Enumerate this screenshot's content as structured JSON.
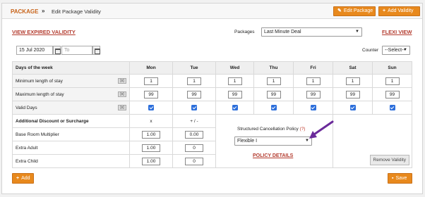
{
  "header": {
    "title": "PACKAGE",
    "separator": "»",
    "breadcrumb": "Edit Package Validity",
    "edit_button": "Edit Package",
    "add_validity_button": "Add Validity"
  },
  "toolbar": {
    "view_expired": "VIEW EXPIRED VALIDITY",
    "packages_label": "Packages",
    "packages_value": "Last Minute Deal",
    "flexi_view": "FLEXI VIEW",
    "from_date": "15 Jul 2020",
    "to_placeholder": "To",
    "counter_label": "Counter",
    "counter_value": "--Select--"
  },
  "grid": {
    "days_header": "Days of the week",
    "days": [
      "Mon",
      "Tue",
      "Wed",
      "Thu",
      "Fri",
      "Sat",
      "Sun"
    ],
    "min_label": "Minimum length of stay",
    "min_values": [
      "1",
      "1",
      "1",
      "1",
      "1",
      "1",
      "1"
    ],
    "max_label": "Maximum length of stay",
    "max_values": [
      "99",
      "99",
      "99",
      "99",
      "99",
      "99",
      "99"
    ],
    "valid_label": "Valid Days",
    "row_icon": "[x]",
    "additional_label": "Additional Discount or Surcharge",
    "x_label": "x",
    "pm_label": "+ / -",
    "base_label": "Base Room Multiplier",
    "base_x": "1.00",
    "base_pm": "0.00",
    "adult_label": "Extra Adult",
    "adult_x": "1.00",
    "adult_pm": "0",
    "child_label": "Extra Child",
    "child_x": "1.00",
    "child_pm": "0"
  },
  "policy": {
    "label": "Structured Cancellation Policy",
    "help": "(?)",
    "value": "Flexible I",
    "details": "POLICY DETAILS",
    "remove_button": "Remove Validity"
  },
  "footer": {
    "add_button": "Add",
    "save_button": "Save"
  },
  "icons": {
    "edit": "edit-icon",
    "plus": "plus-icon",
    "calendar": "calendar-icon",
    "save": "save-icon"
  },
  "colors": {
    "accent": "#e8891d",
    "link": "#b33b2e",
    "checkbox": "#2d6fdb",
    "arrow": "#6a2a9a"
  }
}
